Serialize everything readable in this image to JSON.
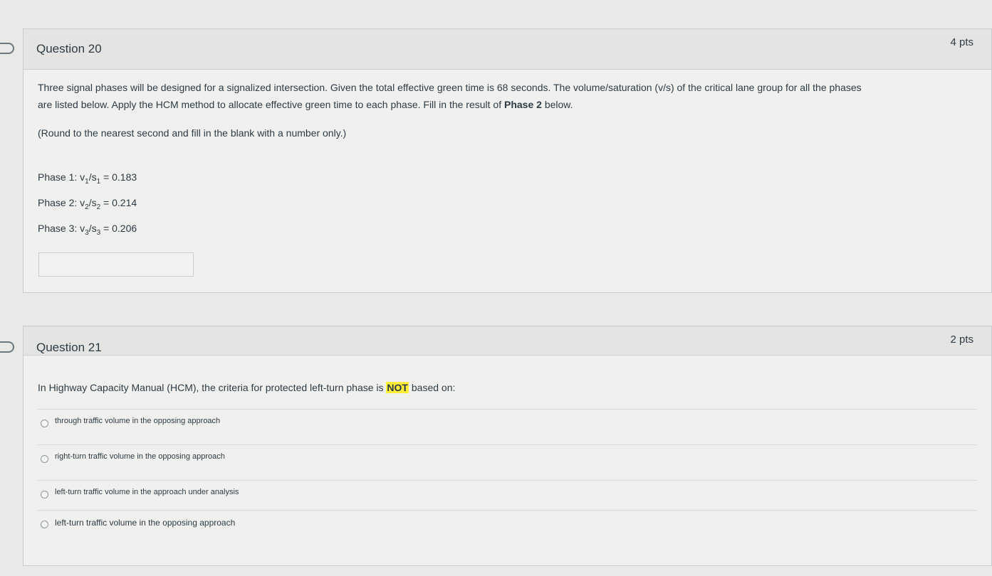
{
  "q20": {
    "title": "Question 20",
    "points": "4 pts",
    "prompt_line1": "Three signal phases will be designed for a signalized intersection.  Given the total effective green time is 68 seconds. The volume/saturation  (v/s) of the critical lane group for all the phases",
    "prompt_line2_pre": "are listed below. Apply the HCM method to allocate effective green time to each phase.  Fill in the result of ",
    "prompt_line2_bold": "Phase 2",
    "prompt_line2_post": " below.",
    "instruction": "(Round to the nearest second and fill in the blank with a number only.)",
    "phases": [
      {
        "label": "Phase 1: v",
        "num": "1",
        "slash": "/s",
        "value": " = 0.183"
      },
      {
        "label": "Phase 2: v",
        "num": "2",
        "slash": "/s",
        "value": " = 0.214"
      },
      {
        "label": "Phase 3: v",
        "num": "3",
        "slash": "/s",
        "value": " = 0.206"
      }
    ],
    "answer_value": ""
  },
  "q21": {
    "title": "Question 21",
    "points": "2 pts",
    "prompt_pre": "In Highway Capacity Manual (HCM), the criteria for protected left-turn phase is ",
    "prompt_highlight": "NOT",
    "prompt_post": " based on:",
    "options": [
      "through traffic volume in the opposing approach",
      "right-turn traffic volume in the opposing approach",
      "left-turn traffic volume in the approach under analysis",
      "left-turn traffic volume in the opposing approach"
    ]
  },
  "icons": {
    "flag": "bookmark-flag-icon",
    "radio": "radio-button-icon"
  }
}
